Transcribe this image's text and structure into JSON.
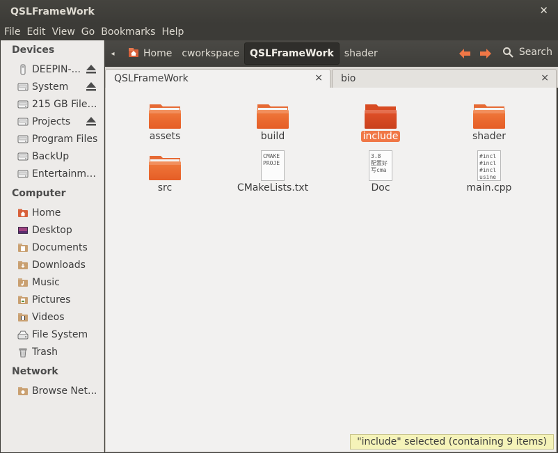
{
  "window": {
    "title": "QSLFrameWork"
  },
  "menubar": [
    "File",
    "Edit",
    "View",
    "Go",
    "Bookmarks",
    "Help"
  ],
  "sidebar": {
    "devices_title": "Devices",
    "devices": [
      {
        "label": "DEEPIN-...",
        "icon": "usb-drive-icon",
        "eject": true
      },
      {
        "label": "System",
        "icon": "drive-icon",
        "eject": true
      },
      {
        "label": "215 GB Files...",
        "icon": "drive-icon",
        "eject": false
      },
      {
        "label": "Projects",
        "icon": "drive-icon",
        "eject": true
      },
      {
        "label": "Program Files",
        "icon": "drive-icon",
        "eject": false
      },
      {
        "label": "BackUp",
        "icon": "drive-icon",
        "eject": false
      },
      {
        "label": "Entertainme...",
        "icon": "drive-icon",
        "eject": false
      }
    ],
    "computer_title": "Computer",
    "computer": [
      {
        "label": "Home",
        "icon": "home-folder-icon"
      },
      {
        "label": "Desktop",
        "icon": "desktop-icon"
      },
      {
        "label": "Documents",
        "icon": "documents-folder-icon"
      },
      {
        "label": "Downloads",
        "icon": "downloads-folder-icon"
      },
      {
        "label": "Music",
        "icon": "music-folder-icon"
      },
      {
        "label": "Pictures",
        "icon": "pictures-folder-icon"
      },
      {
        "label": "Videos",
        "icon": "videos-folder-icon"
      },
      {
        "label": "File System",
        "icon": "filesystem-icon"
      },
      {
        "label": "Trash",
        "icon": "trash-icon"
      }
    ],
    "network_title": "Network",
    "network": [
      {
        "label": "Browse Net...",
        "icon": "network-icon"
      }
    ]
  },
  "pathbar": {
    "crumbs": [
      "Home",
      "cworkspace",
      "QSLFrameWork",
      "shader"
    ],
    "active": "QSLFrameWork",
    "search_label": "Search"
  },
  "tabs": [
    {
      "label": "QSLFrameWork",
      "close": "×"
    },
    {
      "label": "bio",
      "close": "×"
    }
  ],
  "files": [
    {
      "name": "assets",
      "type": "folder"
    },
    {
      "name": "build",
      "type": "folder"
    },
    {
      "name": "include",
      "type": "folder",
      "selected": true
    },
    {
      "name": "shader",
      "type": "folder"
    },
    {
      "name": "src",
      "type": "folder"
    },
    {
      "name": "CMakeLists.txt",
      "type": "text",
      "preview": [
        "CMAKE",
        "",
        "PROJE"
      ]
    },
    {
      "name": "Doc",
      "type": "text",
      "preview": [
        "3.8",
        "配置好",
        "写cma"
      ]
    },
    {
      "name": "main.cpp",
      "type": "text",
      "preview": [
        "#incl",
        "#incl",
        "#incl",
        "usine"
      ]
    }
  ],
  "status": "\"include\" selected (containing 9 items)",
  "colors": {
    "accent": "#f07746",
    "folder": "#e8692f",
    "chrome": "#3c3b37"
  }
}
